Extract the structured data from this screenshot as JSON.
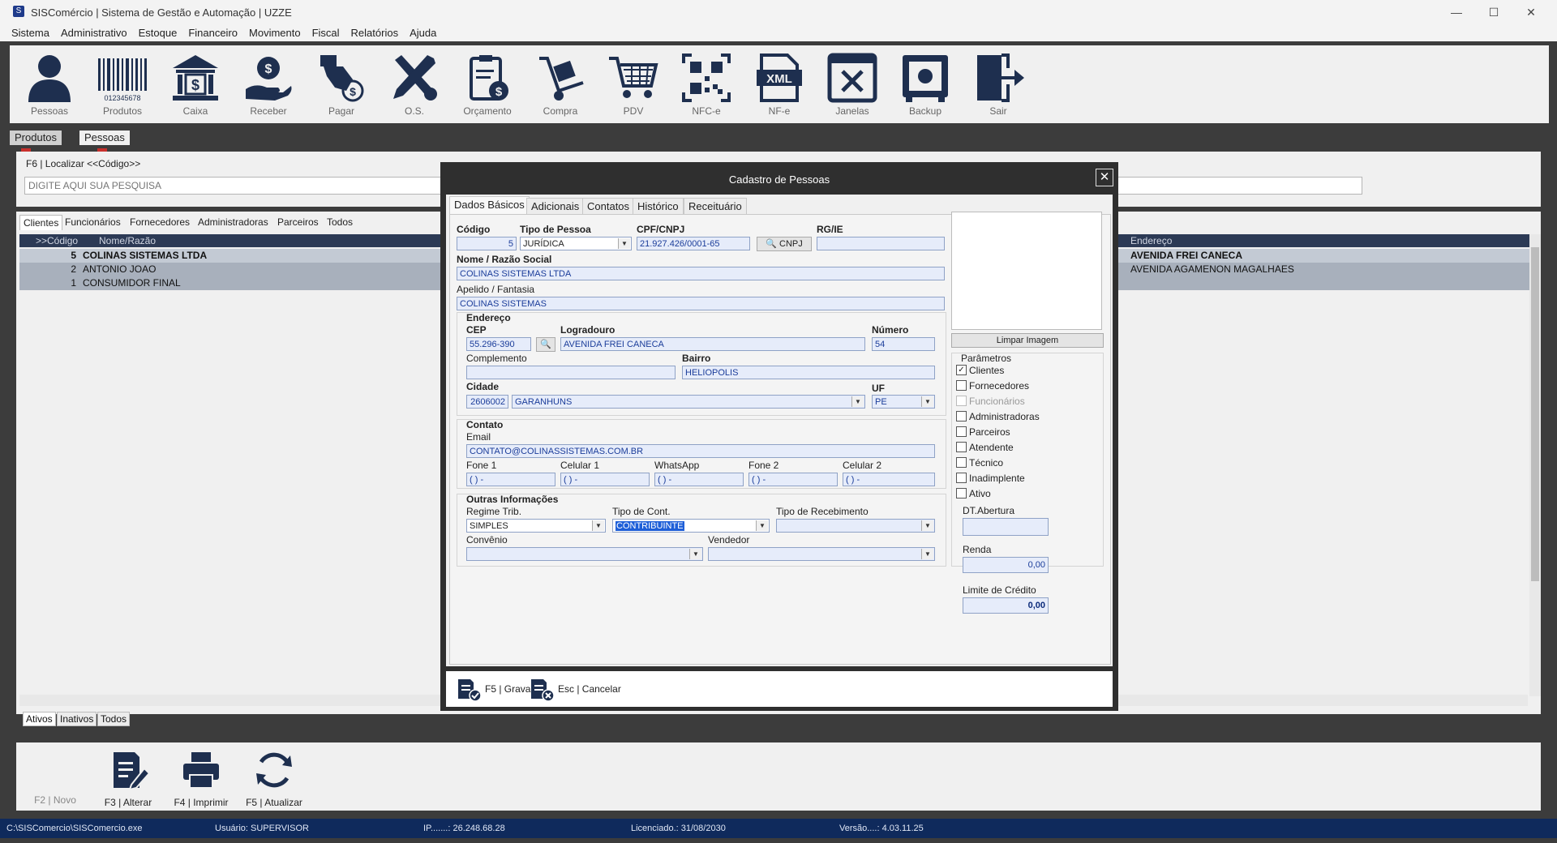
{
  "window": {
    "title": "SISComércio | Sistema de Gestão e Automação | UZZE"
  },
  "menu": [
    "Sistema",
    "Administrativo",
    "Estoque",
    "Financeiro",
    "Movimento",
    "Fiscal",
    "Relatórios",
    "Ajuda"
  ],
  "toolbar": [
    {
      "label": "Pessoas",
      "icon": "person-icon"
    },
    {
      "label": "Produtos",
      "icon": "barcode-icon"
    },
    {
      "label": "Caixa",
      "icon": "bank-icon"
    },
    {
      "label": "Receber",
      "icon": "receive-money-icon"
    },
    {
      "label": "Pagar",
      "icon": "pay-icon"
    },
    {
      "label": "O.S.",
      "icon": "tools-icon"
    },
    {
      "label": "Orçamento",
      "icon": "clipboard-money-icon"
    },
    {
      "label": "Compra",
      "icon": "hand-truck-icon"
    },
    {
      "label": "PDV",
      "icon": "cart-icon"
    },
    {
      "label": "NFC-e",
      "icon": "qrcode-icon"
    },
    {
      "label": "NF-e",
      "icon": "xml-file-icon"
    },
    {
      "label": "Janelas",
      "icon": "close-window-icon"
    },
    {
      "label": "Backup",
      "icon": "safe-icon"
    },
    {
      "label": "Sair",
      "icon": "exit-door-icon"
    }
  ],
  "barcode_text": "012345678",
  "xml_text": "XML",
  "doc_tabs": [
    {
      "label": "Produtos"
    },
    {
      "label": "Pessoas"
    }
  ],
  "doc_tab_close": "x",
  "search": {
    "label": "F6 | Localizar <<Código>>",
    "placeholder": "DIGITE AQUI SUA PESQUISA"
  },
  "grid_tabs": [
    "Clientes",
    "Funcionários",
    "Fornecedores",
    "Administradoras",
    "Parceiros",
    "Todos"
  ],
  "grid": {
    "columns": {
      "code": ">>Código",
      "name": "Nome/Razão",
      "address": "Endereço"
    },
    "rows": [
      {
        "code": "5",
        "name": "COLINAS SISTEMAS LTDA",
        "address": "AVENIDA FREI CANECA"
      },
      {
        "code": "2",
        "name": "ANTONIO JOAO",
        "address": "AVENIDA AGAMENON MAGALHAES"
      },
      {
        "code": "1",
        "name": "CONSUMIDOR FINAL",
        "address": ""
      }
    ]
  },
  "status_tabs": [
    "Ativos",
    "Inativos",
    "Todos"
  ],
  "bottom_actions": [
    "F2 | Novo",
    "F3 | Alterar",
    "F4 | Imprimir",
    "F5 | Atualizar"
  ],
  "statusbar": {
    "path": "C:\\SISComercio\\SISComercio.exe",
    "user": "Usuário: SUPERVISOR",
    "ip": "IP.......: 26.248.68.28",
    "license": "Licenciado.: 31/08/2030",
    "version": "Versão....: 4.03.11.25"
  },
  "dialog": {
    "title": "Cadastro de Pessoas",
    "close": "✕",
    "tabs": [
      "Dados Básicos",
      "Adicionais",
      "Contatos",
      "Histórico",
      "Receituário"
    ],
    "labels": {
      "codigo": "Código",
      "tipo_pessoa": "Tipo de Pessoa",
      "cpf_cnpj": "CPF/CNPJ",
      "rg_ie": "RG/IE",
      "nome": "Nome / Razão Social",
      "apelido": "Apelido / Fantasia",
      "endereco": "Endereço",
      "cep": "CEP",
      "logradouro": "Logradouro",
      "numero": "Número",
      "complemento": "Complemento",
      "bairro": "Bairro",
      "cidade": "Cidade",
      "uf": "UF",
      "contato": "Contato",
      "email": "Email",
      "fone1": "Fone 1",
      "celular1": "Celular 1",
      "whatsapp": "WhatsApp",
      "fone2": "Fone 2",
      "celular2": "Celular 2",
      "outras": "Outras Informações",
      "regime": "Regime Trib.",
      "tipo_cont": "Tipo de Cont.",
      "tipo_receb": "Tipo de Recebimento",
      "convenio": "Convênio",
      "vendedor": "Vendedor",
      "parametros": "Parâmetros",
      "dt_abertura": "DT.Abertura",
      "renda": "Renda",
      "limite": "Limite de Crédito"
    },
    "values": {
      "codigo": "5",
      "tipo_pessoa": "JURÍDICA",
      "cpf_cnpj": "21.927.426/0001-65",
      "rg_ie": "",
      "nome": "COLINAS SISTEMAS LTDA",
      "apelido": "COLINAS SISTEMAS",
      "cep": "55.296-390",
      "logradouro": "AVENIDA FREI CANECA",
      "numero": "54",
      "complemento": "",
      "bairro": "HELIOPOLIS",
      "cidade_cod": "2606002",
      "cidade": "GARANHUNS",
      "uf": "PE",
      "email": "CONTATO@COLINASSISTEMAS.COM.BR",
      "fone1": "( )   -",
      "celular1": "( )    -",
      "whatsapp": "( )    -",
      "fone2": "( )   -",
      "celular2": "( )    -",
      "regime": "SIMPLES",
      "tipo_cont": "CONTRIBUINTE",
      "tipo_receb": "",
      "convenio": "",
      "vendedor": "",
      "dt_abertura": "",
      "renda": "0,00",
      "limite": "0,00"
    },
    "cnpj_button": "CNPJ",
    "clear_image": "Limpar Imagem",
    "parametros": [
      {
        "label": "Clientes",
        "checked": true,
        "disabled": false
      },
      {
        "label": "Fornecedores",
        "checked": false,
        "disabled": false
      },
      {
        "label": "Funcionários",
        "checked": false,
        "disabled": true
      },
      {
        "label": "Administradoras",
        "checked": false,
        "disabled": false
      },
      {
        "label": "Parceiros",
        "checked": false,
        "disabled": false
      },
      {
        "label": "Atendente",
        "checked": false,
        "disabled": false
      },
      {
        "label": "Técnico",
        "checked": false,
        "disabled": false
      },
      {
        "label": "Inadimplente",
        "checked": false,
        "disabled": false
      },
      {
        "label": "Ativo",
        "checked": false,
        "disabled": false
      }
    ],
    "footer": {
      "save": "F5 | Gravar",
      "cancel": "Esc | Cancelar"
    }
  }
}
